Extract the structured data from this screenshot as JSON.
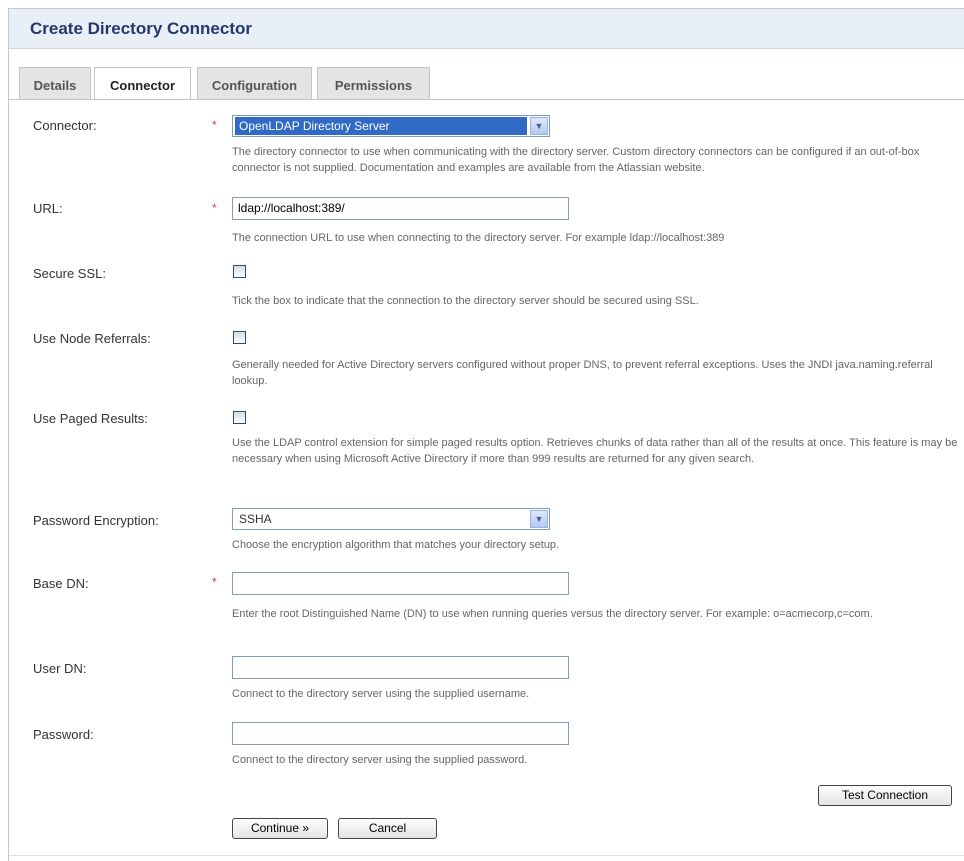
{
  "page": {
    "title": "Create Directory Connector"
  },
  "tabs": [
    {
      "label": "Details"
    },
    {
      "label": "Connector"
    },
    {
      "label": "Configuration"
    },
    {
      "label": "Permissions"
    }
  ],
  "form": {
    "required_marker": "*",
    "connector": {
      "label": "Connector:",
      "value": "OpenLDAP Directory Server",
      "help": "The directory connector to use when communicating with the directory server. Custom directory connectors can be configured if an out-of-box connector is not supplied. Documentation and examples are available from the Atlassian website."
    },
    "url": {
      "label": "URL:",
      "value": "ldap://localhost:389/",
      "help": "The connection URL to use when connecting to the directory server. For example ldap://localhost:389"
    },
    "secure_ssl": {
      "label": "Secure SSL:",
      "checked": false,
      "help": "Tick the box to indicate that the connection to the directory server should be secured using SSL."
    },
    "node_referrals": {
      "label": "Use Node Referrals:",
      "checked": false,
      "help": "Generally needed for Active Directory servers configured without proper DNS, to prevent referral exceptions. Uses the JNDI java.naming.referral lookup."
    },
    "paged_results": {
      "label": "Use Paged Results:",
      "checked": false,
      "help": "Use the LDAP control extension for simple paged results option. Retrieves chunks of data rather than all of the results at once. This feature is may be necessary when using Microsoft Active Directory if more than 999 results are returned for any given search."
    },
    "password_encryption": {
      "label": "Password Encryption:",
      "value": "SSHA",
      "help": "Choose the encryption algorithm that matches your directory setup."
    },
    "base_dn": {
      "label": "Base DN:",
      "value": "",
      "help": "Enter the root Distinguished Name (DN) to use when running queries versus the directory server. For example: o=acmecorp,c=com."
    },
    "user_dn": {
      "label": "User DN:",
      "value": "",
      "help": "Connect to the directory server using the supplied username."
    },
    "password": {
      "label": "Password:",
      "value": "",
      "help": "Connect to the directory server using the supplied password."
    }
  },
  "buttons": {
    "test_connection": "Test Connection",
    "continue": "Continue »",
    "cancel": "Cancel"
  }
}
